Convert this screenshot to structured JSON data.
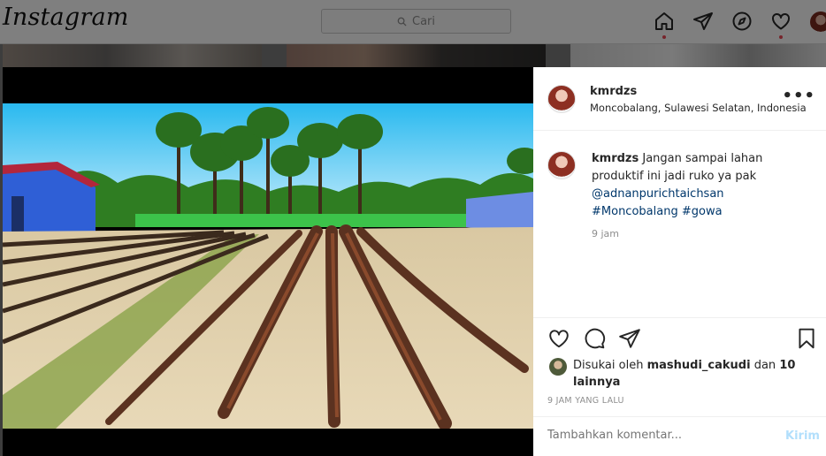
{
  "app": {
    "logo": "Instagram"
  },
  "search": {
    "placeholder": "Cari",
    "icon": "search-icon"
  },
  "nav": {
    "icons": [
      "home-icon",
      "direct-send-icon",
      "explore-compass-icon",
      "activity-heart-icon",
      "profile-avatar"
    ],
    "notification_color": "#ed4956"
  },
  "post": {
    "username": "kmrdzs",
    "location": "Moncobalang, Sulawesi Selatan, Indonesia",
    "more_icon": "•••",
    "caption": {
      "username": "kmrdzs",
      "text": "Jangan sampai lahan produktif ini jadi ruko ya pak",
      "mention": "@adnanpurichtaichsan",
      "hashtags": [
        "#Moncobalang",
        "#gowa"
      ],
      "time": "9 jam"
    },
    "likes": {
      "prefix": "Disukai oleh",
      "first_liker": "mashudi_cakudi",
      "joiner": "dan",
      "others": "10 lainnya"
    },
    "timestamp": "9 JAM YANG LALU",
    "comment": {
      "placeholder": "Tambahkan komentar...",
      "post_label": "Kirim"
    }
  },
  "colors": {
    "link": "#00376b",
    "muted": "#8e8e8e",
    "post_button": "#b2dffc"
  }
}
